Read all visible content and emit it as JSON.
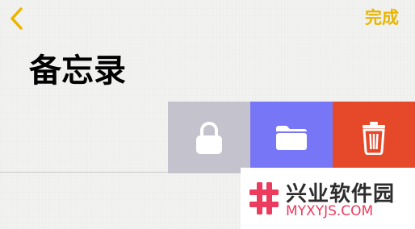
{
  "colors": {
    "accent": "#e8b600",
    "lock_action": "#c4c2cc",
    "move_action": "#7776f7",
    "delete_action": "#e5492a",
    "watermark_accent": "#ec3b5e"
  },
  "header": {
    "back_icon": "chevron-left-icon",
    "done_label": "完成"
  },
  "main": {
    "title": "备忘录"
  },
  "swipe_actions": [
    {
      "name": "lock",
      "icon": "lock-icon"
    },
    {
      "name": "move",
      "icon": "folder-icon"
    },
    {
      "name": "delete",
      "icon": "trash-icon"
    }
  ],
  "watermark": {
    "title": "兴业软件园",
    "url": "MYXYJS.COM",
    "icon": "hash-logo-icon"
  }
}
